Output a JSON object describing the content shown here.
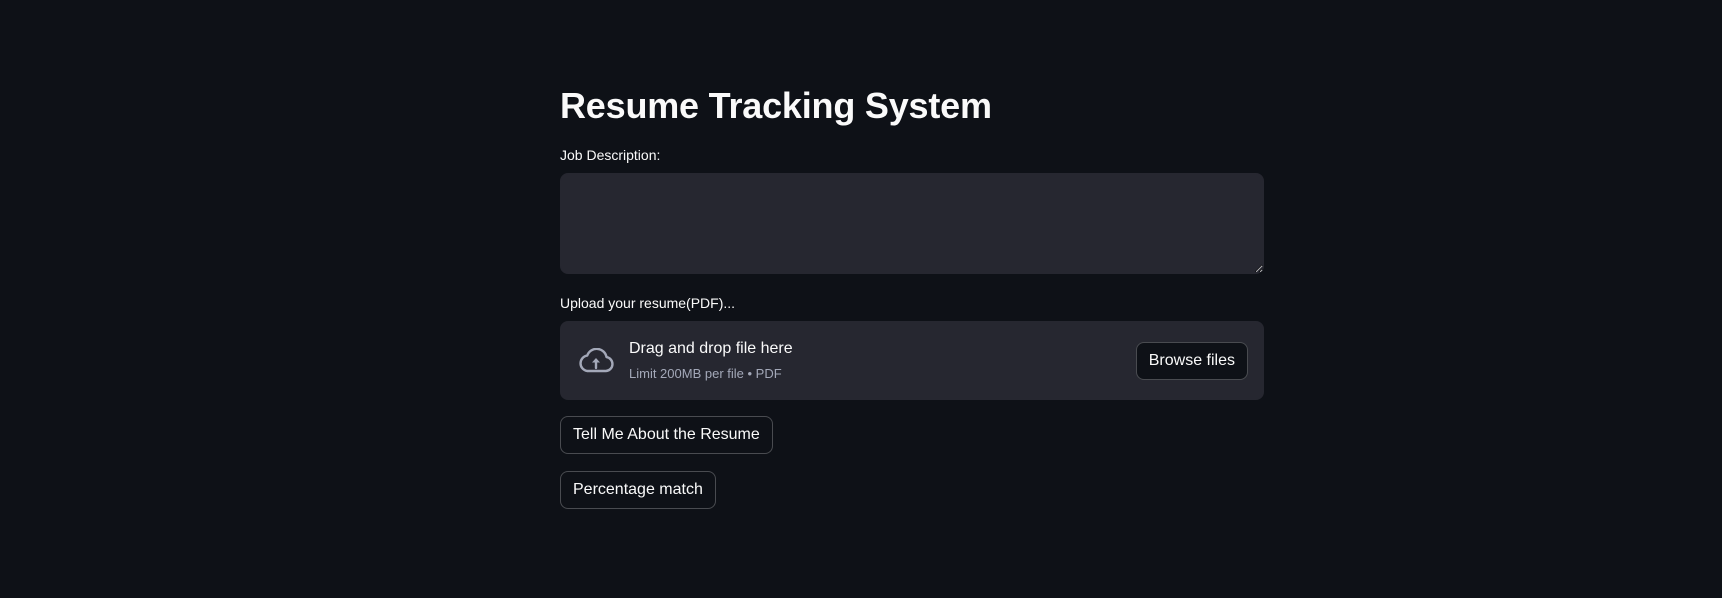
{
  "page": {
    "title": "Resume Tracking System"
  },
  "job_description": {
    "label": "Job Description:",
    "value": "",
    "placeholder": ""
  },
  "uploader": {
    "label": "Upload your resume(PDF)...",
    "drop_text": "Drag and drop file here",
    "limit_text": "Limit 200MB per file • PDF",
    "browse_label": "Browse files",
    "icon": "cloud-upload-icon"
  },
  "actions": {
    "tell_me_label": "Tell Me About the Resume",
    "percentage_label": "Percentage match"
  },
  "theme": {
    "background": "#0e1117",
    "surface": "#262730",
    "text": "#fafafa",
    "muted_text": "#a3a8b8"
  }
}
